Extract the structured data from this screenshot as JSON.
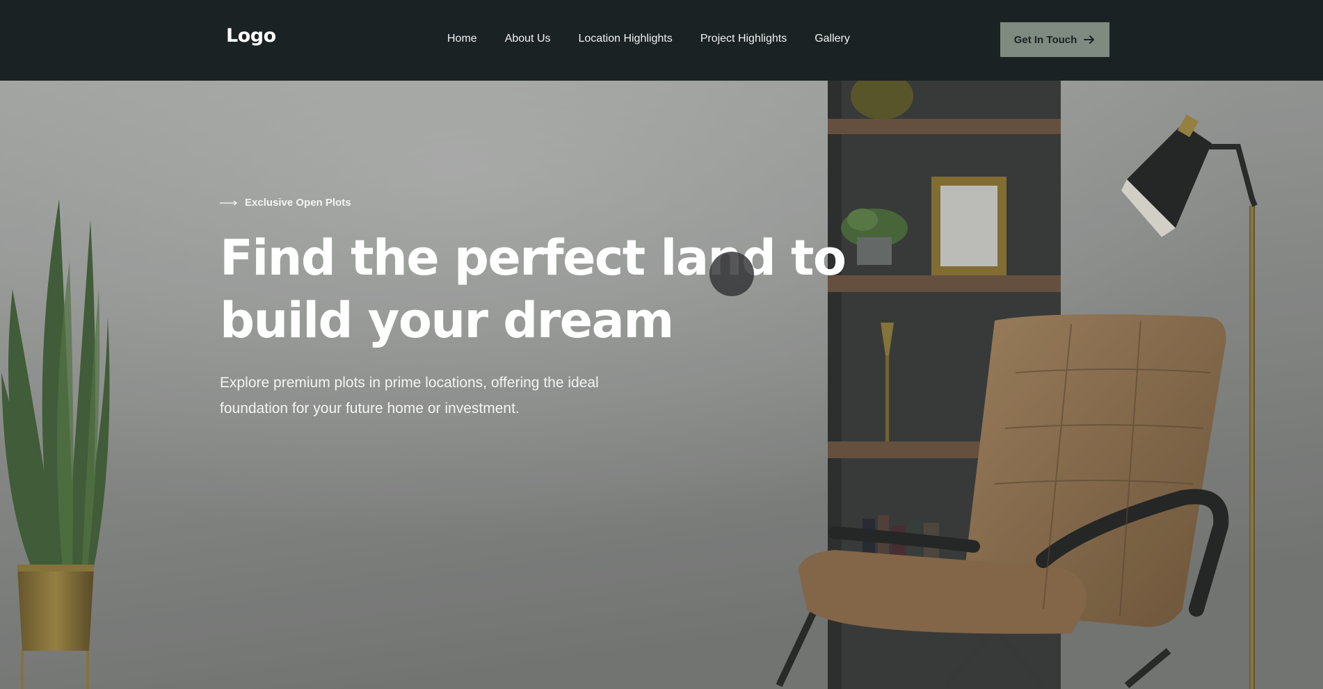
{
  "header": {
    "logo": "Logo",
    "nav": [
      "Home",
      "About Us",
      "Location Highlights",
      "Project Highlights",
      "Gallery"
    ],
    "cta_label": "Get In Touch",
    "cta_icon": "arrow-right-icon"
  },
  "hero": {
    "eyebrow": "Exclusive Open Plots",
    "eyebrow_icon": "long-arrow-right-icon",
    "headline": "Find the perfect land to build your dream",
    "subtitle": "Explore premium plots in prime locations, offering the ideal foundation for your future home or investment."
  },
  "colors": {
    "navbar": "#1b2224",
    "cta_background": "#7f8a80",
    "hero_wall": "#8c8c8a",
    "text": "#ffffff"
  }
}
